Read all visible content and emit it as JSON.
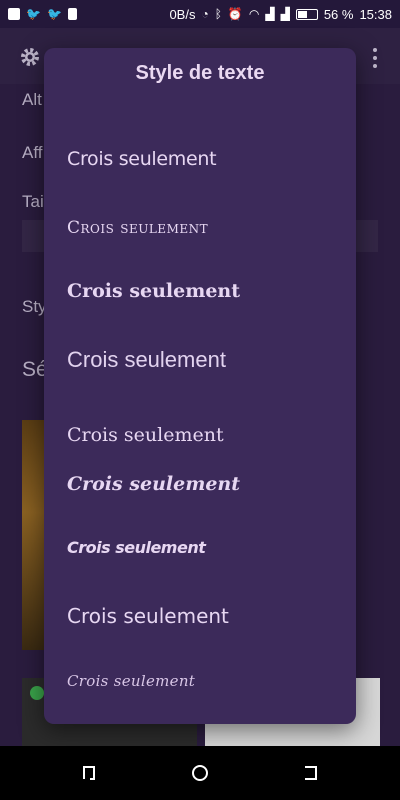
{
  "status_bar": {
    "net_speed": "0B/s",
    "battery_percent": "56 %",
    "battery_level": 0.56,
    "time": "15:38",
    "icons": [
      "facebook-icon",
      "twitter-icon",
      "twitter-icon",
      "sim-icon",
      "sync-icon",
      "bluetooth-icon",
      "alarm-icon",
      "wifi-icon",
      "signal-icon",
      "signal-icon"
    ]
  },
  "background": {
    "labels": [
      "Alt",
      "Aff",
      "Tai",
      "Sty",
      "Sé"
    ]
  },
  "dialog": {
    "title": "Style de texte",
    "options": [
      "Crois seulement",
      "Crois seulement",
      "Crois seulement",
      "Crois seulement",
      "Crois seulement",
      "Crois seulement",
      "Crois seulement",
      "Crois seulement",
      "Crois seulement"
    ]
  },
  "colors": {
    "dialog_bg": "#3c2a5a",
    "text": "#e7d7f2",
    "screen_bg": "#2a1c3e"
  }
}
